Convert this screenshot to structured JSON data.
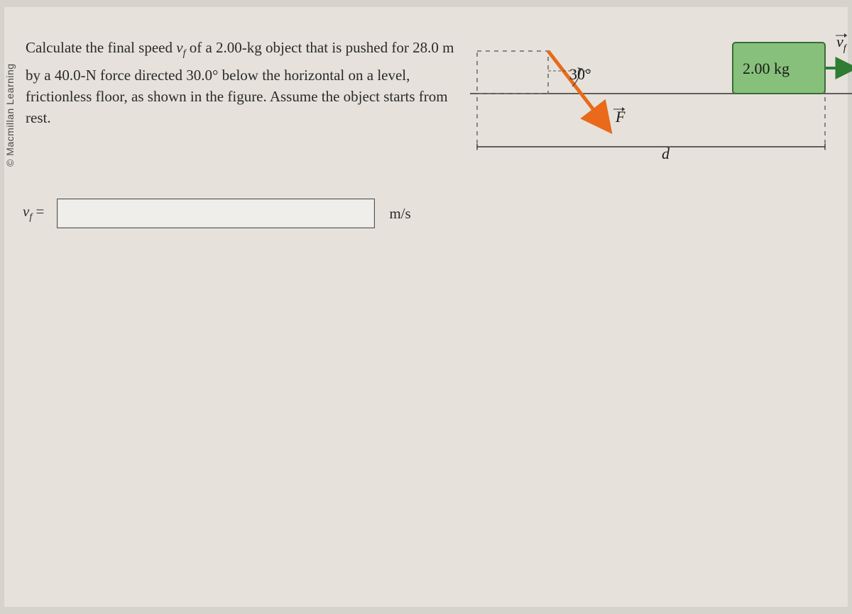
{
  "copyright": "© Macmillan Learning",
  "question": {
    "text_plain": "Calculate the final speed vf of a 2.00-kg object that is pushed for 28.0 m by a 40.0-N force directed 30.0° below the horizontal on a level, frictionless floor, as shown in the figure. Assume the object starts from rest.",
    "seg1": "Calculate the final speed ",
    "var_v": "v",
    "sub_f": "f",
    "seg2": " of a 2.00-kg object that is pushed for 28.0 m by a 40.0-N force directed 30.0° below the horizontal on a level, frictionless floor, as shown in the figure. Assume the object starts from rest."
  },
  "answer": {
    "label_v": "v",
    "label_f": "f",
    "equals": " =",
    "value": "",
    "units": "m/s"
  },
  "diagram": {
    "mass": "2.00 kg",
    "angle": "30°",
    "force": "F",
    "distance": "d",
    "velocity_v": "v",
    "velocity_f": "f"
  }
}
